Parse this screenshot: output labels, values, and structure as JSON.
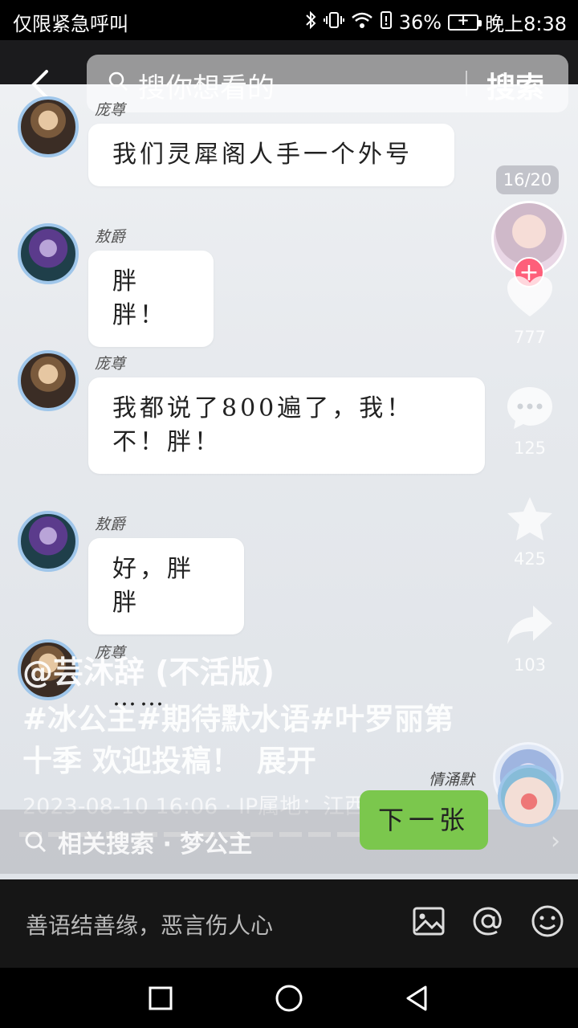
{
  "status_bar": {
    "carrier": "仅限紧急呼叫",
    "battery": "36%",
    "time": "晚上8:38"
  },
  "search": {
    "placeholder": "搜你想看的",
    "button": "搜索"
  },
  "messages": [
    {
      "sender": "庞尊",
      "text": "我们灵犀阁人手一个外号",
      "side": "left",
      "avatar": "pangzun"
    },
    {
      "sender": "敖爵",
      "text": "胖胖！",
      "side": "left",
      "avatar": "aojue"
    },
    {
      "sender": "庞尊",
      "text": "我都说了800遍了，我！不！胖！",
      "side": "left",
      "avatar": "pangzun"
    },
    {
      "sender": "敖爵",
      "text": "好，胖胖",
      "side": "left",
      "avatar": "aojue"
    },
    {
      "sender": "庞尊",
      "text": "……",
      "side": "left",
      "avatar": "pangzun"
    },
    {
      "sender": "情涌默",
      "text": "下一张",
      "side": "right",
      "avatar": "qingyongmo"
    }
  ],
  "video": {
    "image_counter": "16/20",
    "author": "@芸沐辞  (不活版)",
    "description": "#冰公主#期待默水语#叶罗丽第十季  欢迎投稿！",
    "expand": "展开",
    "meta": "2023-08-10 16:06 · IP属地：江西",
    "likes": "777",
    "comments": "125",
    "favorites": "425",
    "shares": "103"
  },
  "related_search": {
    "text": "相关搜索 · 梦公主"
  },
  "comment_input": {
    "placeholder": "善语结善缘，恶言伤人心"
  },
  "colors": {
    "accent_pink": "#fe5f7a",
    "bubble_green": "#7bc74d",
    "avatar_ring": "#9fc6ea"
  }
}
